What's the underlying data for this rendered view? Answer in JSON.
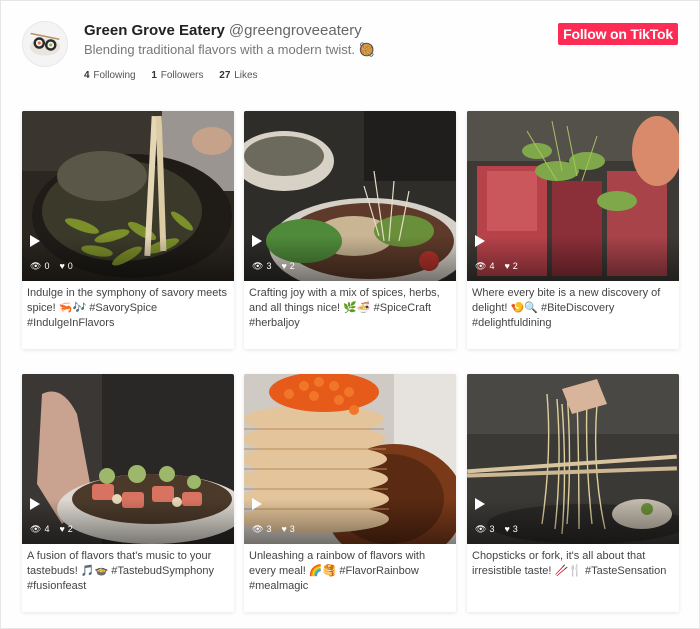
{
  "profile": {
    "display_name": "Green Grove Eatery",
    "handle": "@greengroveeatery",
    "bio": "Blending traditional flavors with a modern twist. 🥘",
    "avatar_icon": "sushi-avatar-icon",
    "stats": {
      "following_count": "4",
      "following_label": "Following",
      "followers_count": "1",
      "followers_label": "Followers",
      "likes_count": "27",
      "likes_label": "Likes"
    },
    "follow_button": "Follow on TikTok"
  },
  "colors": {
    "accent": "#fe2c55",
    "text_primary": "#222222",
    "text_secondary": "#777777"
  },
  "videos": [
    {
      "views": "0",
      "likes": "0",
      "caption": "Indulge in the symphony of savory meets spice! 🦐🎶 #SavorySpice #IndulgeInFlavors",
      "image": "edamame-wok-chopsticks"
    },
    {
      "views": "3",
      "likes": "2",
      "caption": "Crafting joy with a mix of spices, herbs, and all things nice! 🌿🍜 #SpiceCraft #herbaljoy",
      "image": "herb-noodle-bowl"
    },
    {
      "views": "4",
      "likes": "2",
      "caption": "Where every bite is a new discovery of delight! 🍤🔍 #BiteDiscovery #delightfuldining",
      "image": "seared-tuna-microgreens"
    },
    {
      "views": "4",
      "likes": "2",
      "caption": "A fusion of flavors that's music to your tastebuds! 🎵🍲 #TastebudSymphony #fusionfeast",
      "image": "sushi-plate-hand"
    },
    {
      "views": "3",
      "likes": "3",
      "caption": "Unleashing a rainbow of flavors with every meal! 🌈🥞 #FlavorRainbow #mealmagic",
      "image": "crepe-stack-roe"
    },
    {
      "views": "3",
      "likes": "3",
      "caption": "Chopsticks or fork, it's all about that irresistible taste! 🥢🍴 #TasteSensation",
      "image": "noodles-chopsticks"
    }
  ]
}
